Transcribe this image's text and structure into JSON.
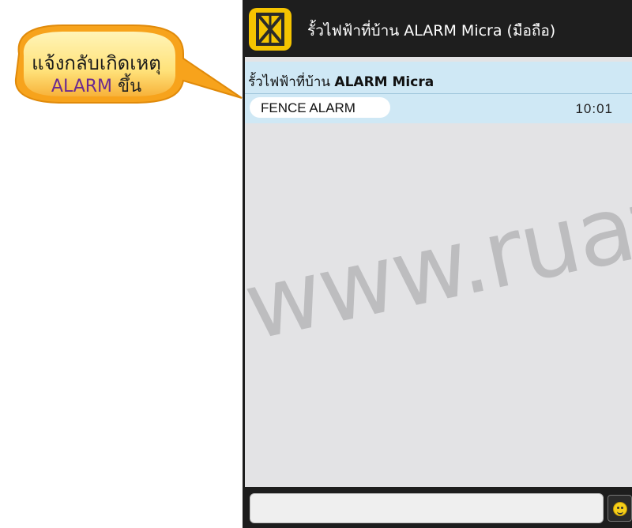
{
  "callout": {
    "line1": "แจ้งกลับเกิดเหตุ",
    "line2_alarm": "ALARM",
    "line2_rest": " ขึ้น"
  },
  "titlebar": {
    "icon": "app-logo-icon",
    "title": "รั้วไฟฟ้าที่บ้าน ALARM Micra (มือถือ)"
  },
  "thread": {
    "name_prefix": "รั้วไฟฟ้าที่บ้าน ",
    "name_bold": "ALARM  Micra"
  },
  "message": {
    "text": "FENCE ALARM",
    "time": "10:01"
  },
  "watermark": "www.ruafa",
  "compose": {
    "value": "",
    "placeholder": "",
    "emoji_icon": "smiley-icon"
  },
  "colors": {
    "icon_yellow": "#f5c400",
    "header_blue": "#cfe8f5",
    "callout_orange": "#f7a31c",
    "alarm_purple": "#6a2a90"
  }
}
